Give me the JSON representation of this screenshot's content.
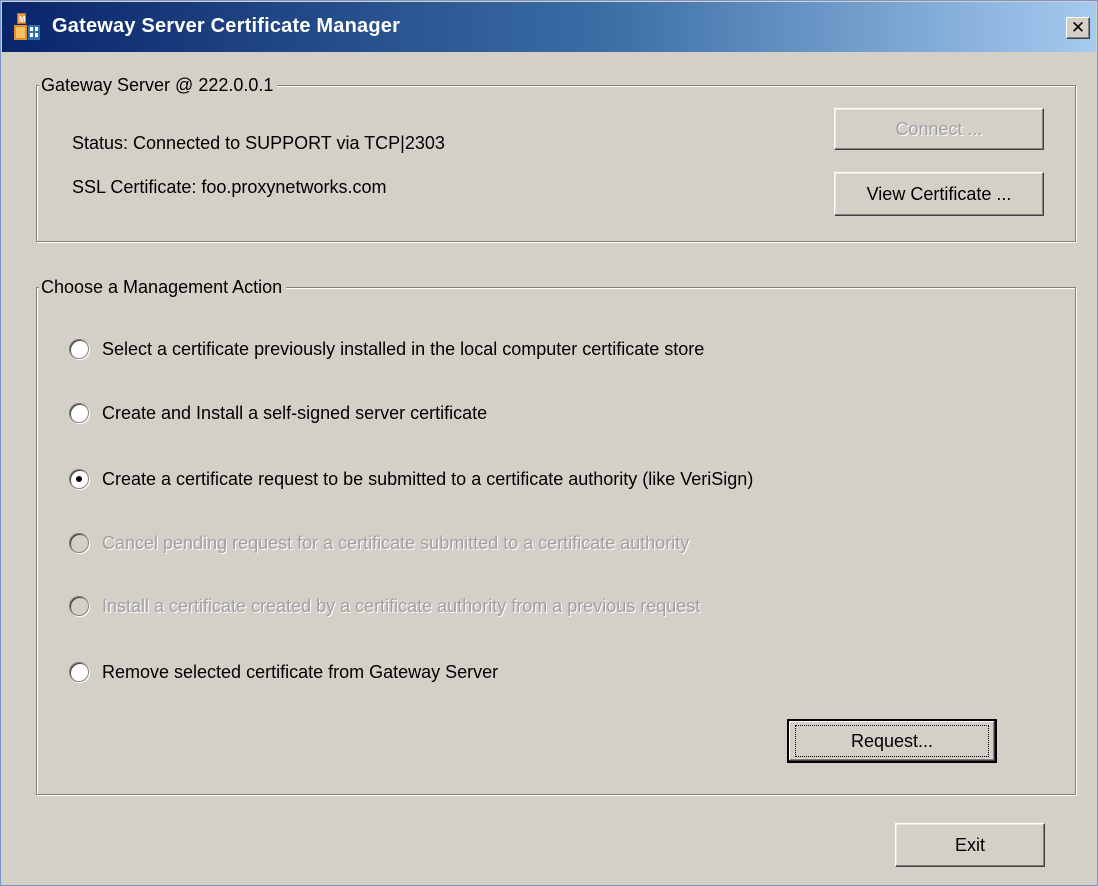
{
  "window": {
    "title": "Gateway Server Certificate Manager",
    "close_label": "✕"
  },
  "server_group": {
    "legend": "Gateway Server @ 222.0.0.1",
    "status": "Status:  Connected to SUPPORT via TCP|2303",
    "ssl": "SSL Certificate:  foo.proxynetworks.com",
    "connect_label": "Connect ...",
    "connect_enabled": false,
    "view_cert_label": "View Certificate ..."
  },
  "action_group": {
    "legend": "Choose a Management Action",
    "options": [
      {
        "label": "Select a certificate previously installed in the local computer certificate store",
        "selected": false,
        "enabled": true
      },
      {
        "label": "Create and Install a self-signed server certificate",
        "selected": false,
        "enabled": true
      },
      {
        "label": "Create a certificate request to be submitted to a certificate authority (like VeriSign)",
        "selected": true,
        "enabled": true
      },
      {
        "label": "Cancel pending request for a certificate submitted to a certificate authority",
        "selected": false,
        "enabled": false
      },
      {
        "label": "Install a certificate created by a certificate authority from a previous request",
        "selected": false,
        "enabled": false
      },
      {
        "label": "Remove selected certificate from Gateway Server",
        "selected": false,
        "enabled": true
      }
    ],
    "request_label": "Request..."
  },
  "footer": {
    "exit_label": "Exit"
  },
  "colors": {
    "titlebar_start": "#0a246a",
    "titlebar_end": "#a6caf0",
    "dialog_bg": "#d4d0c8",
    "disabled_text": "#a0a0a0"
  }
}
